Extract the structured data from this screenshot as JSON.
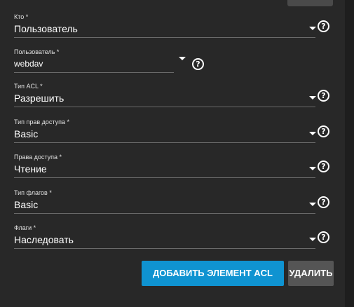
{
  "form": {
    "who": {
      "label": "Кто *",
      "value": "Пользователь"
    },
    "user": {
      "label": "Пользователь *",
      "value": "webdav"
    },
    "acl_type": {
      "label": "Тип ACL *",
      "value": "Разрешить"
    },
    "perm_type": {
      "label": "Тип прав доступа *",
      "value": "Basic"
    },
    "permissions": {
      "label": "Права доступа *",
      "value": "Чтение"
    },
    "flags_type": {
      "label": "Тип флагов *",
      "value": "Basic"
    },
    "flags": {
      "label": "Флаги *",
      "value": "Наследовать"
    }
  },
  "help_glyph": "?",
  "icons": {
    "dropdown": "chevron-down-icon",
    "help": "help-circle-icon"
  },
  "buttons": {
    "add_label": "ДОБАВИТЬ ЭЛЕМЕНТ ACL",
    "delete_label": "УДАЛИТЬ"
  },
  "colors": {
    "background": "#1e1e1e",
    "panel": "#282828",
    "primary": "#0f93d1",
    "secondary": "#555555",
    "text": "#ffffff"
  }
}
